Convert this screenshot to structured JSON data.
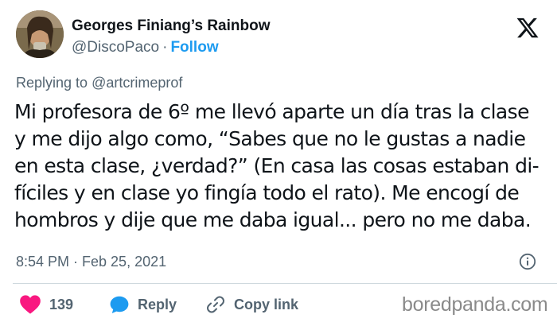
{
  "user": {
    "display_name": "Georges Finiang’s Rainbow",
    "handle": "@DiscoPaco",
    "separator": "·",
    "follow_label": "Follow"
  },
  "reply_context": {
    "prefix": "Replying to",
    "mention": "@artcrimeprof"
  },
  "tweet": {
    "lines": [
      "Mi profesora de 6º me llevó aparte un día tras la clase",
      "y me dijo algo como, “Sabes que no le gustas a nadie",
      "en esta clase, ¿verdad?” (En casa las cosas estaban di-",
      "fíciles y en clase yo fingía todo el rato). Me encogí de",
      "hombros y dije que me daba igual... pero no me daba."
    ],
    "timestamp": "8:54 PM · Feb 25, 2021"
  },
  "actions": {
    "like_count": "139",
    "reply_label": "Reply",
    "copy_link_label": "Copy link"
  },
  "watermark": "boredpanda.com",
  "icons": {
    "logo": "x-logo-icon",
    "info": "info-icon",
    "like": "heart-icon",
    "reply": "reply-bubble-icon",
    "copy": "link-icon"
  },
  "colors": {
    "accent": "#1d9bf0",
    "like": "#f91880",
    "text": "#0f1419",
    "muted": "#536471"
  }
}
